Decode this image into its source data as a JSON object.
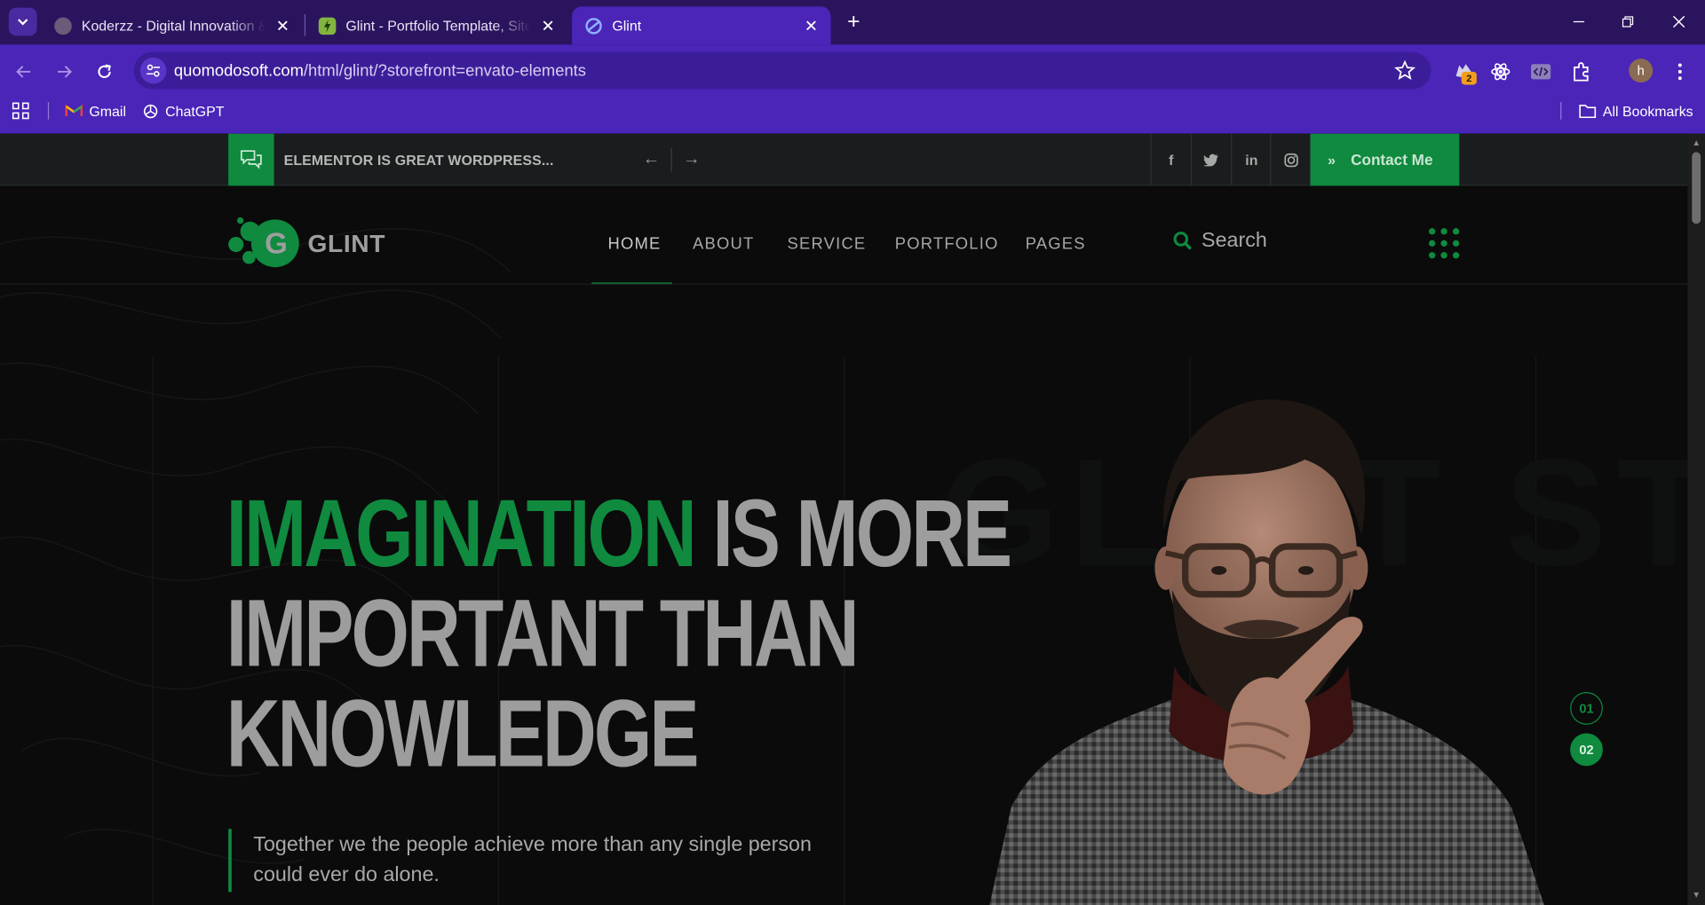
{
  "browser": {
    "tabs": [
      {
        "title": "Koderzz - Digital Innovation & Excellence",
        "active": false
      },
      {
        "title": "Glint - Portfolio Template, Site Templates",
        "active": false
      },
      {
        "title": "Glint",
        "active": true
      }
    ],
    "url_host": "quomodosoft.com",
    "url_path": "/html/glint/?storefront=envato-elements",
    "extension_badge": "2",
    "profile_initial": "h",
    "bookmarks": [
      "Gmail",
      "ChatGPT"
    ],
    "all_bookmarks": "All Bookmarks"
  },
  "topbar": {
    "news_text": "ELEMENTOR IS GREAT WORDPRESS...",
    "social": [
      "facebook",
      "twitter",
      "linkedin",
      "instagram"
    ],
    "social_glyphs": {
      "facebook": "f",
      "linkedin": "in"
    },
    "contact_label": "Contact Me"
  },
  "header": {
    "logo_text": "GLINT",
    "logo_letter": "G",
    "menu": [
      "HOME",
      "ABOUT",
      "SERVICE",
      "PORTFOLIO",
      "PAGES"
    ],
    "active_menu": "HOME",
    "search_placeholder": "Search"
  },
  "hero": {
    "headline_highlight": "IMAGINATION",
    "headline_line1_rest": " IS MORE",
    "headline_line2": "IMPORTANT THAN",
    "headline_line3": "KNOWLEDGE",
    "quote": "Together we the people achieve more than any single person could ever do alone.",
    "slides": [
      "01",
      "02"
    ],
    "active_slide": "02"
  },
  "colors": {
    "brand_green": "#0f8a3f",
    "browser_purple": "#4a25b8",
    "page_bg": "#0b0b0b"
  }
}
